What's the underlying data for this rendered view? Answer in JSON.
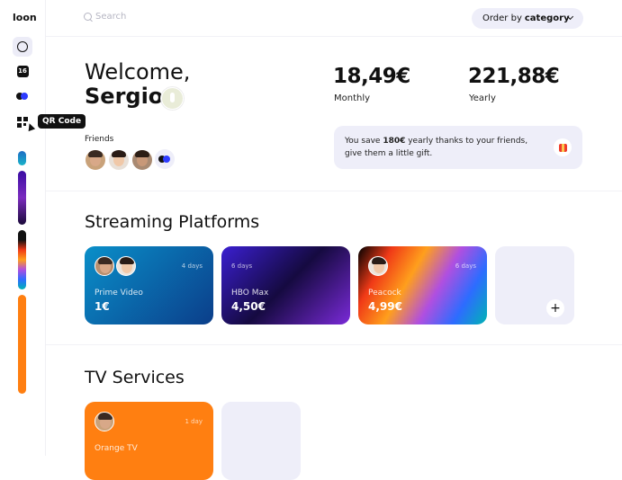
{
  "app": {
    "logo": "loon"
  },
  "sidebar": {
    "calendar_day": "16",
    "tooltip": "QR Code",
    "bars": [
      {
        "colors": [
          "#1e6cc4",
          "#19b3c9"
        ]
      },
      {
        "colors": [
          "#3a0ca3",
          "#7b2cbf",
          "#1a0a3a"
        ]
      },
      {
        "colors": [
          "#111111",
          "#111111",
          "#f03a17",
          "#ff9f1c",
          "#b04fe0",
          "#2d6cff",
          "#00b4b4"
        ]
      },
      {
        "colors": [
          "#ff7f11",
          "#ff7f11"
        ]
      }
    ]
  },
  "topbar": {
    "search_placeholder": "Search",
    "order_prefix": "Order by",
    "order_value": "category"
  },
  "welcome": {
    "greeting": "Welcome,",
    "name": "Sergio",
    "friends_label": "Friends"
  },
  "stats": {
    "monthly_value": "18,49€",
    "monthly_label": "Monthly",
    "yearly_value": "221,88€",
    "yearly_label": "Yearly"
  },
  "savings": {
    "prefix": "You save ",
    "amount": "180€",
    "suffix": " yearly thanks to your friends,",
    "line2": "give them a little gift."
  },
  "sections": {
    "streaming_title": "Streaming Platforms",
    "tv_title": "TV Services"
  },
  "streaming": [
    {
      "name": "Prime Video",
      "price": "1€",
      "days": "4 days",
      "colors": [
        "#0a8fc9",
        "#0b3e8a"
      ]
    },
    {
      "name": "HBO Max",
      "price": "4,50€",
      "days": "6 days",
      "colors": [
        "#3b1fd1",
        "#150a40",
        "#7a2ad8"
      ]
    },
    {
      "name": "Peacock",
      "price": "4,99€",
      "days": "6 days",
      "colors": [
        "#000000",
        "#f03a17",
        "#ff9f1c",
        "#b04fe0",
        "#2d6cff",
        "#00b4b4"
      ]
    }
  ],
  "tv": [
    {
      "name": "Orange TV",
      "days": "1 day",
      "colors": [
        "#ff7f11",
        "#ff7f11"
      ]
    }
  ]
}
